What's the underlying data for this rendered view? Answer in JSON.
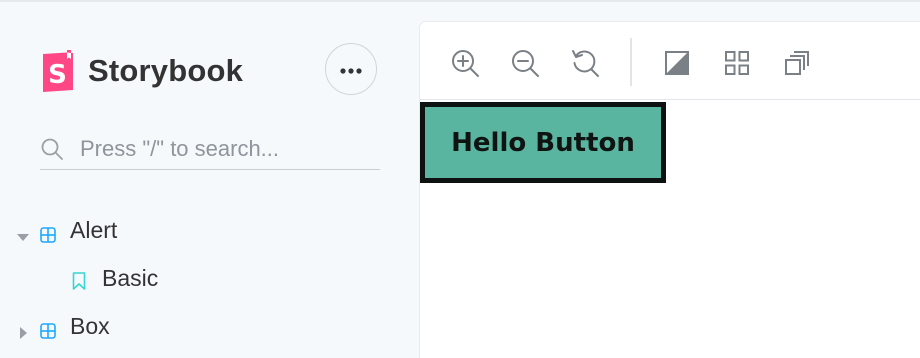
{
  "brand": {
    "name": "Storybook",
    "logo_letter": "S",
    "logo_color": "#ff4785"
  },
  "sidebar": {
    "menu_icon": "ellipsis-icon",
    "search": {
      "placeholder": "Press \"/\" to search...",
      "value": ""
    },
    "tree": [
      {
        "label": "Alert",
        "type": "component",
        "expanded": true
      },
      {
        "label": "Basic",
        "type": "story"
      },
      {
        "label": "Box",
        "type": "component",
        "expanded": false
      }
    ]
  },
  "toolbar": {
    "tools": [
      "zoom-in-icon",
      "zoom-out-icon",
      "reset-zoom-icon",
      "background-icon",
      "grid-icon",
      "outline-icon"
    ]
  },
  "canvas": {
    "button_label": "Hello Button",
    "button_color": "#5ab5a0",
    "button_border": "#0d1110"
  },
  "colors": {
    "sidebar_bg": "#f6f9fc",
    "component_icon": "#1ea7fd",
    "story_icon": "#37d5d3",
    "icon_gray": "#7a8086"
  }
}
